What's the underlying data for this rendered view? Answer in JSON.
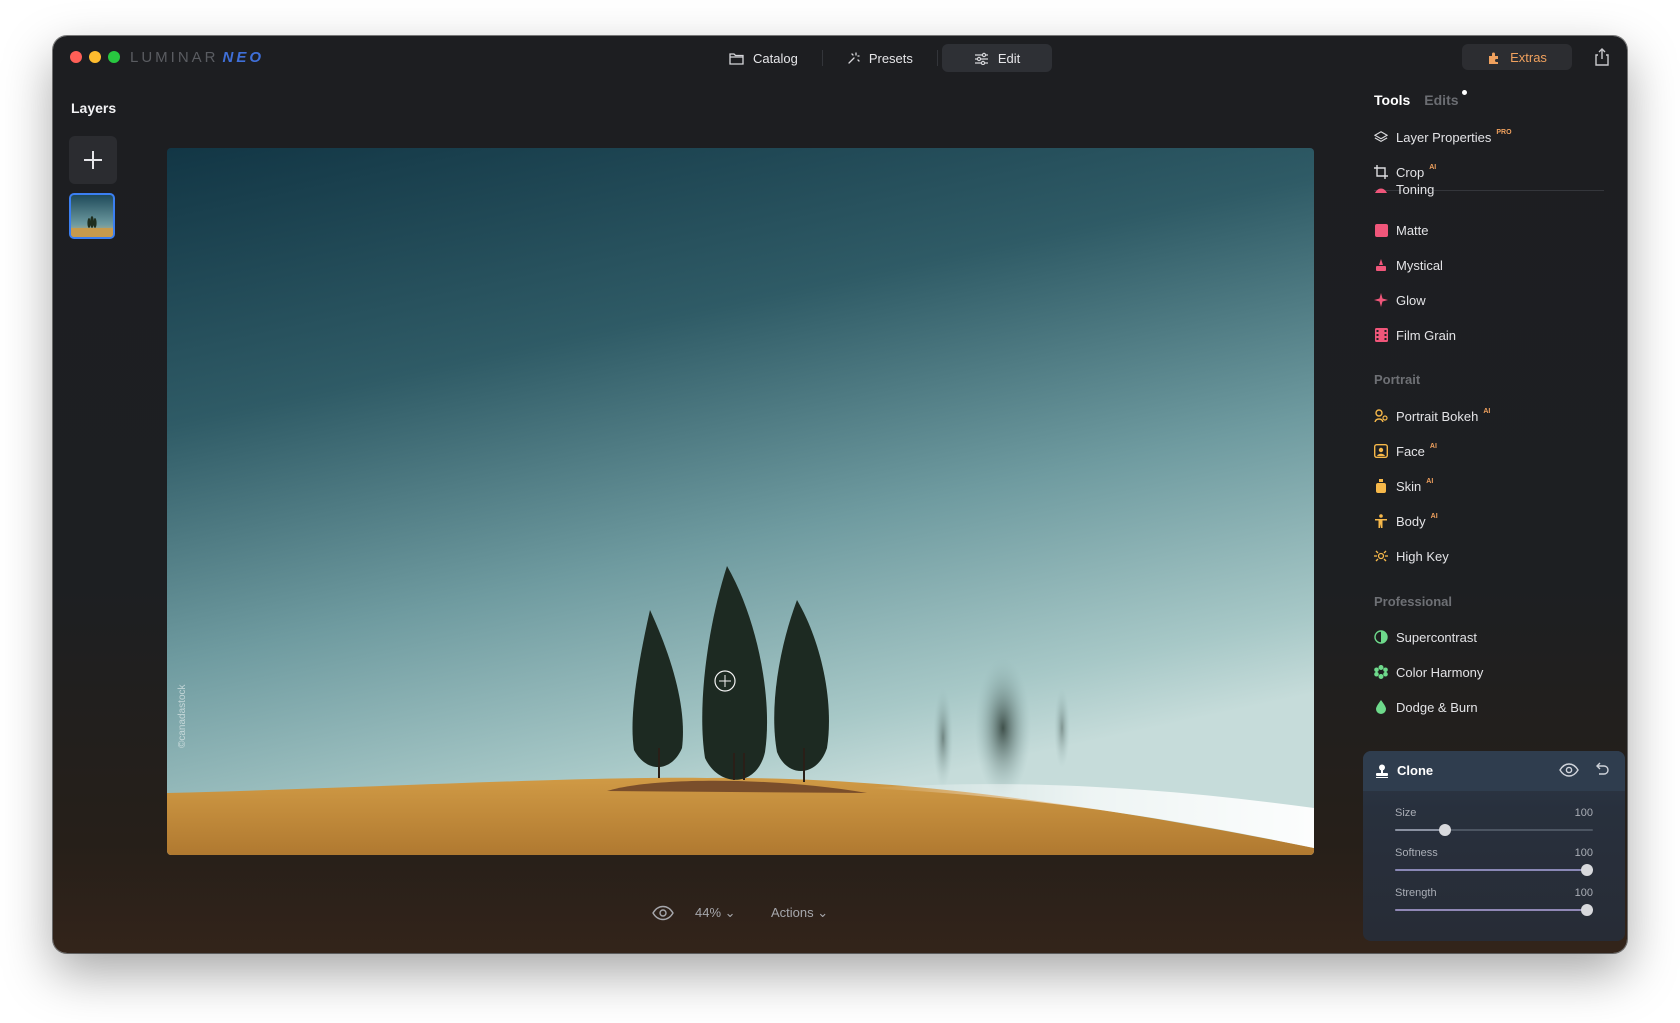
{
  "app": {
    "logo_part1": "LUMINAR",
    "logo_part2": "NEO"
  },
  "nav": {
    "tabs": [
      {
        "label": "Catalog",
        "icon": "folder-icon"
      },
      {
        "label": "Presets",
        "icon": "sparkle-icon"
      },
      {
        "label": "Edit",
        "icon": "sliders-icon",
        "active": true
      }
    ],
    "extras_label": "Extras"
  },
  "layers": {
    "title": "Layers"
  },
  "canvas": {
    "watermark": "©canadastock"
  },
  "bottom": {
    "zoom": "44% ⌄",
    "actions": "Actions ⌄"
  },
  "panel": {
    "tab_tools": "Tools",
    "tab_edits": "Edits",
    "pinned": [
      {
        "label": "Layer Properties",
        "tag": "PRO",
        "icon": "layers-icon"
      },
      {
        "label": "Crop",
        "tag": "AI",
        "icon": "crop-icon"
      }
    ],
    "creative_tools": [
      {
        "label": "Toning",
        "icon": "toning-icon",
        "color": "#f0567a"
      },
      {
        "label": "Matte",
        "icon": "matte-icon",
        "color": "#f0567a"
      },
      {
        "label": "Mystical",
        "icon": "mystical-icon",
        "color": "#f0567a"
      },
      {
        "label": "Glow",
        "icon": "glow-icon",
        "color": "#f0567a"
      },
      {
        "label": "Film Grain",
        "icon": "film-grain-icon",
        "color": "#f0567a"
      }
    ],
    "portrait_section": "Portrait",
    "portrait_tools": [
      {
        "label": "Portrait Bokeh",
        "tag": "AI",
        "icon": "bokeh-icon",
        "color": "#f6b84a"
      },
      {
        "label": "Face",
        "tag": "AI",
        "icon": "face-icon",
        "color": "#f6b84a"
      },
      {
        "label": "Skin",
        "tag": "AI",
        "icon": "skin-icon",
        "color": "#f6b84a"
      },
      {
        "label": "Body",
        "tag": "AI",
        "icon": "body-icon",
        "color": "#f6b84a"
      },
      {
        "label": "High Key",
        "icon": "high-key-icon",
        "color": "#f6b84a"
      }
    ],
    "professional_section": "Professional",
    "professional_tools": [
      {
        "label": "Supercontrast",
        "icon": "supercontrast-icon",
        "color": "#6ed98b"
      },
      {
        "label": "Color Harmony",
        "icon": "color-harmony-icon",
        "color": "#6ed98b"
      },
      {
        "label": "Dodge & Burn",
        "icon": "dodge-burn-icon",
        "color": "#6ed98b"
      }
    ],
    "clone": {
      "title": "Clone",
      "sliders": [
        {
          "label": "Size",
          "value": "100",
          "fraction": 0.25
        },
        {
          "label": "Softness",
          "value": "100",
          "fraction": 0.97
        },
        {
          "label": "Strength",
          "value": "100",
          "fraction": 0.97
        }
      ]
    }
  }
}
